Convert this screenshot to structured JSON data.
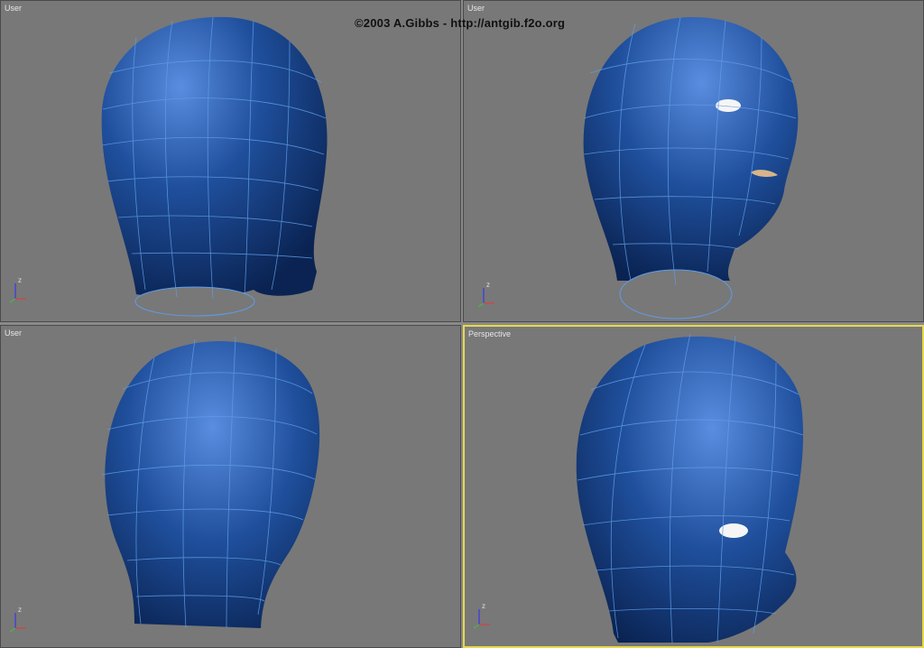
{
  "credit": "©2003 A.Gibbs - http://antgib.f2o.org",
  "colors": {
    "viewport_bg": "#787878",
    "active_border": "#e8d84a",
    "mesh_blue": "#1f4f9c",
    "wire": "#5f9de8"
  },
  "viewports": [
    {
      "label": "User",
      "active": false,
      "view": "back-right"
    },
    {
      "label": "User",
      "active": false,
      "view": "front-right"
    },
    {
      "label": "User",
      "active": false,
      "view": "top-back"
    },
    {
      "label": "Perspective",
      "active": true,
      "view": "front-right-close"
    }
  ],
  "axes": {
    "x": "x",
    "y": "y",
    "z": "z"
  }
}
